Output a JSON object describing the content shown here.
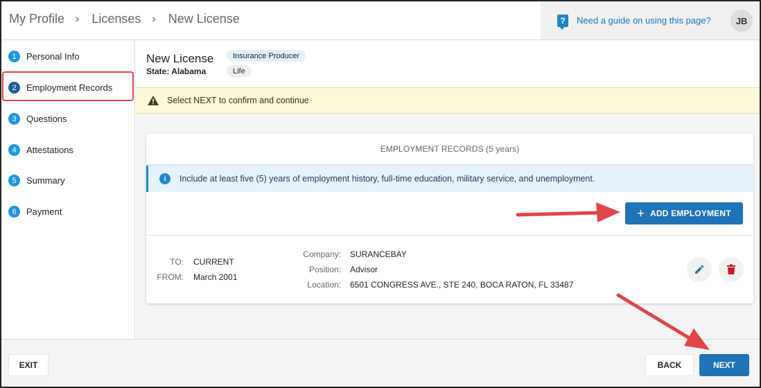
{
  "breadcrumb": [
    "My Profile",
    "Licenses",
    "New License"
  ],
  "breadcrumb_separator": "›",
  "guide_link": "Need a guide on using this page?",
  "user_initials": "JB",
  "steps": [
    {
      "number": "1",
      "label": "Personal Info"
    },
    {
      "number": "2",
      "label": "Employment Records"
    },
    {
      "number": "3",
      "label": "Questions"
    },
    {
      "number": "4",
      "label": "Attestations"
    },
    {
      "number": "5",
      "label": "Summary"
    },
    {
      "number": "6",
      "label": "Payment"
    }
  ],
  "license": {
    "title": "New License",
    "state": "State: Alabama",
    "tags": [
      "Insurance Producer",
      "Life"
    ]
  },
  "alert": "Select NEXT to confirm and continue",
  "employment": {
    "title": "EMPLOYMENT RECORDS (5 years)",
    "info": "Include at least five (5) years of employment history, full-time education, military service, and unemployment.",
    "add_button": "ADD EMPLOYMENT",
    "record": {
      "to_label": "TO:",
      "to_value": "CURRENT",
      "from_label": "FROM:",
      "from_value": "March 2001",
      "company_label": "Company:",
      "company_value": "SURANCEBAY",
      "position_label": "Position:",
      "position_value": "Advisor",
      "location_label": "Location:",
      "location_value": "6501 CONGRESS AVE., STE 240, BOCA RATON, FL 33487"
    }
  },
  "footer": {
    "exit": "EXIT",
    "back": "BACK",
    "next": "NEXT"
  },
  "colors": {
    "primary": "#1f74b8",
    "step_circle": "#1f96dd",
    "annotation_red": "#e0454a",
    "delete_red": "#c8191f"
  }
}
